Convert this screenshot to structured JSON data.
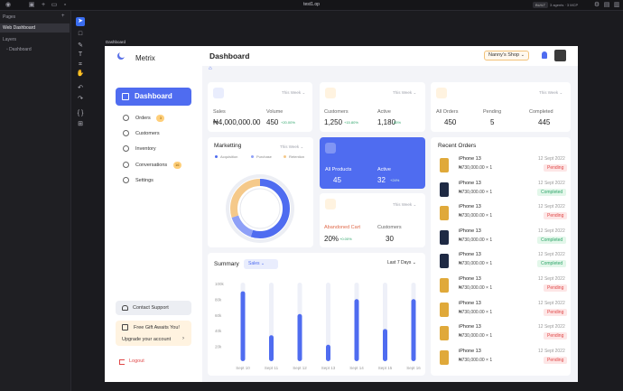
{
  "app": {
    "window_title": "test1.op",
    "mode_badge": "BUILT",
    "agents_status": "3 agents · 3 MCP",
    "left_panel": {
      "pages_label": "Pages",
      "add_icon": "plus-icon",
      "pages": [
        "Web Dashboard"
      ],
      "layers_label": "Layers",
      "layers": [
        "Dashboard"
      ]
    },
    "frame_label": "Dashboard",
    "tools": [
      "cursor-icon",
      "frame-icon",
      "pen-icon",
      "text-icon",
      "crop-icon",
      "hand-icon",
      "undo-icon",
      "redo-icon",
      "code-icon",
      "grid-icon"
    ]
  },
  "dashboard": {
    "brand": "Metrix",
    "nav": {
      "active": "Dashboard",
      "items": [
        {
          "label": "Orders",
          "badge": "3",
          "icon": "bag-icon"
        },
        {
          "label": "Customers",
          "badge": "",
          "icon": "users-icon"
        },
        {
          "label": "Inventory",
          "badge": "",
          "icon": "folder-icon"
        },
        {
          "label": "Conversations",
          "badge": "16",
          "icon": "chat-icon"
        },
        {
          "label": "Settings",
          "badge": "",
          "icon": "gear-icon"
        }
      ]
    },
    "support": "Contact Support",
    "gift": {
      "title": "Free Gift Awaits You!",
      "cta": "Upgrade your account"
    },
    "logout": "Logout",
    "header": {
      "title": "Dashboard",
      "shop": "Nanny's Shop"
    },
    "period": "This Week",
    "sales_card": {
      "labels": [
        "Sales",
        "Volume"
      ],
      "values": [
        "₦4,000,000.00",
        "450"
      ],
      "deltas": [
        "",
        "+20.00%"
      ]
    },
    "customers_card": {
      "labels": [
        "Customers",
        "Active"
      ],
      "values": [
        "1,250",
        "1,180"
      ],
      "deltas": [
        "+15.80%",
        "85%"
      ]
    },
    "orders_card": {
      "labels": [
        "All Orders",
        "Pending",
        "Completed"
      ],
      "values": [
        "450",
        "5",
        "445"
      ]
    },
    "marketing": {
      "title": "Marketting",
      "legend": [
        "Acquisition",
        "Purchase",
        "Retention"
      ],
      "colors": [
        "#4f6cf0",
        "#8ea0f7",
        "#f5c98a"
      ]
    },
    "products_card": {
      "labels": [
        "All Products",
        "Active"
      ],
      "values": [
        "45",
        "32"
      ],
      "delta": "+24%"
    },
    "cart_card": {
      "labels": [
        "Abandoned Cart",
        "Customers"
      ],
      "values": [
        "20%",
        "30"
      ],
      "delta": "+0.00%"
    },
    "recent_orders": {
      "title": "Recent Orders",
      "items": [
        {
          "name": "iPhone 13",
          "price": "₦730,000.00 × 1",
          "date": "12 Sept 2022",
          "status": "Pending"
        },
        {
          "name": "iPhone 13",
          "price": "₦730,000.00 × 1",
          "date": "12 Sept 2022",
          "status": "Completed"
        },
        {
          "name": "iPhone 13",
          "price": "₦730,000.00 × 1",
          "date": "12 Sept 2022",
          "status": "Pending"
        },
        {
          "name": "iPhone 13",
          "price": "₦730,000.00 × 1",
          "date": "12 Sept 2022",
          "status": "Completed"
        },
        {
          "name": "iPhone 13",
          "price": "₦730,000.00 × 1",
          "date": "12 Sept 2022",
          "status": "Completed"
        },
        {
          "name": "iPhone 13",
          "price": "₦730,000.00 × 1",
          "date": "12 Sept 2022",
          "status": "Pending"
        },
        {
          "name": "iPhone 13",
          "price": "₦730,000.00 × 1",
          "date": "12 Sept 2022",
          "status": "Pending"
        },
        {
          "name": "iPhone 13",
          "price": "₦730,000.00 × 1",
          "date": "12 Sept 2022",
          "status": "Pending"
        },
        {
          "name": "iPhone 13",
          "price": "₦730,000.00 × 1",
          "date": "12 Sept 2022",
          "status": "Pending"
        }
      ]
    },
    "summary": {
      "title": "Summary",
      "select": "Sales",
      "range": "Last 7 Days"
    }
  },
  "chart_data": [
    {
      "type": "pie",
      "categories": [
        "Acquisition",
        "Purchase",
        "Retention"
      ],
      "values": [
        55,
        15,
        30
      ]
    },
    {
      "type": "bar",
      "categories": [
        "Sept 10",
        "Sept 11",
        "Sept 12",
        "Sept 13",
        "Sept 14",
        "Sept 15",
        "Sept 16"
      ],
      "values": [
        89,
        33,
        60,
        21,
        79,
        41,
        79
      ],
      "ylim": [
        0,
        100
      ],
      "y_ticks": [
        "100k",
        "80k",
        "60k",
        "40k",
        "20k"
      ]
    }
  ]
}
